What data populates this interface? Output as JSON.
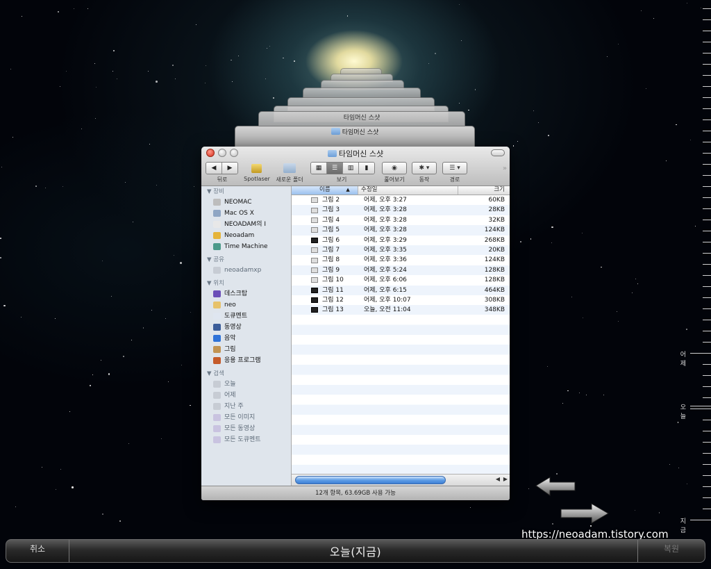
{
  "window": {
    "title": "타임머신 스샷",
    "toolbar": {
      "back_label": "뒤로",
      "spotlaser_label": "Spotlaser",
      "new_folder_label": "새로운 폴더",
      "view_label": "보기",
      "quicklook_label": "훑어보기",
      "action_label": "동작",
      "path_label": "경로"
    },
    "sidebar": {
      "sections": [
        {
          "header": "장비",
          "items": [
            "NEOMAC",
            "Mac OS X",
            "NEOADAM의 I",
            "Neoadam",
            "Time Machine"
          ]
        },
        {
          "header": "공유",
          "items": [
            "neoadamxp"
          ]
        },
        {
          "header": "위치",
          "items": [
            "데스크탑",
            "neo",
            "도큐멘트",
            "동영상",
            "음악",
            "그림",
            "응용 프로그램"
          ]
        },
        {
          "header": "검색",
          "items": [
            "오늘",
            "어제",
            "지난 주",
            "모든 이미지",
            "모든 동영상",
            "모든 도큐멘트"
          ]
        }
      ]
    },
    "columns": {
      "name": "이름",
      "date": "수정일",
      "size": "크기"
    },
    "files": [
      {
        "name": "그림 2",
        "date": "어제, 오후 3:27",
        "size": "60KB"
      },
      {
        "name": "그림 3",
        "date": "어제, 오후 3:28",
        "size": "28KB"
      },
      {
        "name": "그림 4",
        "date": "어제, 오후 3:28",
        "size": "32KB"
      },
      {
        "name": "그림 5",
        "date": "어제, 오후 3:28",
        "size": "124KB"
      },
      {
        "name": "그림 6",
        "date": "어제, 오후 3:29",
        "size": "268KB"
      },
      {
        "name": "그림 7",
        "date": "어제, 오후 3:35",
        "size": "20KB"
      },
      {
        "name": "그림 8",
        "date": "어제, 오후 3:36",
        "size": "124KB"
      },
      {
        "name": "그림 9",
        "date": "어제, 오후 5:24",
        "size": "128KB"
      },
      {
        "name": "그림 10",
        "date": "어제, 오후 6:06",
        "size": "128KB"
      },
      {
        "name": "그림 11",
        "date": "어제, 오후 6:15",
        "size": "464KB"
      },
      {
        "name": "그림 12",
        "date": "어제, 오후 10:07",
        "size": "308KB"
      },
      {
        "name": "그림 13",
        "date": "오늘, 오전 11:04",
        "size": "348KB"
      }
    ],
    "status": "12개 항목, 63.69GB 사용 가능"
  },
  "timeline": {
    "yesterday": "어제",
    "today": "오늘",
    "now": "지금"
  },
  "bottom_bar": {
    "cancel": "취소",
    "current": "오늘(지금)",
    "restore": "복원"
  },
  "watermark": "https://neoadam.tistory.com",
  "colors": {
    "accent": "#3c7ed4",
    "close": "#d52a1a",
    "row_alt": "#eef4fc",
    "sidebar": "#dfe5ec"
  }
}
